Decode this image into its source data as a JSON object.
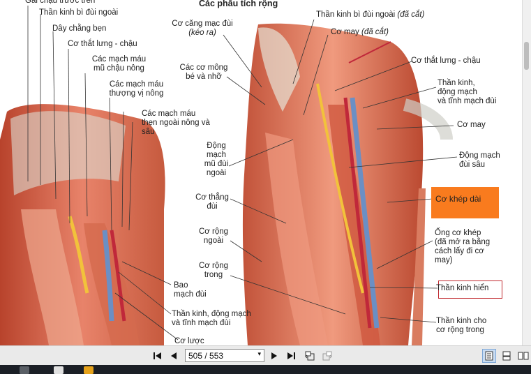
{
  "viewer": {
    "title": "Các phẫu tích rộng",
    "left_labels": {
      "gai_chau_truoc_tren": "Gai chậu trước trên",
      "than_kinh_bi_dui_ngoai": "Thần kinh bì đùi ngoài",
      "day_chang_ben": "Dây chằng bẹn",
      "co_that_lung_chau": "Cơ thắt lưng - chậu",
      "mach_mu_chau_1": "Các mạch máu",
      "mach_mu_chau_2": "mũ chậu nông",
      "mach_thuong_vi_1": "Các mạch máu",
      "mach_thuong_vi_2": "thượng vị nông",
      "mach_then_1": "Các mạch máu",
      "mach_then_2": "thẹn ngoài nông và",
      "mach_then_3": "sâu",
      "bao_mach_1": "Bao",
      "bao_mach_2": "mạch đùi",
      "tk_dm_tm_1": "Thần kinh, động mạch",
      "tk_dm_tm_2": "và tĩnh mạch đùi",
      "co_luoc": "Cơ lược"
    },
    "center_labels": {
      "co_cang_1": "Cơ căng mạc đùi",
      "co_cang_2": "(kéo ra)",
      "co_mong_1": "Các cơ mông",
      "co_mong_2": "bé và nhỡ",
      "dm_mu_1": "Động",
      "dm_mu_2": "mạch",
      "dm_mu_3": "mũ đùi",
      "dm_mu_4": "ngoài",
      "co_thang_1": "Cơ thẳng",
      "co_thang_2": "đùi",
      "rong_ngoai_1": "Cơ rộng",
      "rong_ngoai_2": "ngoài",
      "rong_trong_1": "Cơ rộng",
      "rong_trong_2": "trong"
    },
    "right_labels": {
      "tk_bi_dui_cat": "Thần kinh bì đùi ngoài",
      "tk_bi_dui_cat_note": "(đã cắt)",
      "co_may_cat": "Cơ may",
      "co_may_cat_note": "(đã cắt)",
      "co_that_lung_chau_r": "Cơ thắt lưng - chậu",
      "tk_dm_1": "Thần kinh,",
      "tk_dm_2": "động mạch",
      "tk_dm_3": "và tĩnh mạch đùi",
      "co_may": "Cơ may",
      "dm_dui_sau_1": "Động mạch",
      "dm_dui_sau_2": "đùi sâu",
      "co_khep_dai": "Cơ khép dài",
      "ong_co_khep_1": "Ống cơ khép",
      "ong_co_khep_2": "(đã mở ra bằng",
      "ong_co_khep_3": "cách lấy đi cơ",
      "ong_co_khep_4": "may)",
      "tk_hien": "Thần kinh hiển",
      "tk_cho_1": "Thần kinh cho",
      "tk_cho_2": "cơ rộng trong"
    }
  },
  "toolbar": {
    "page_value": "505 / 553",
    "highlight_orange": "#f97b1e",
    "highlight_box": "#c0272d"
  }
}
